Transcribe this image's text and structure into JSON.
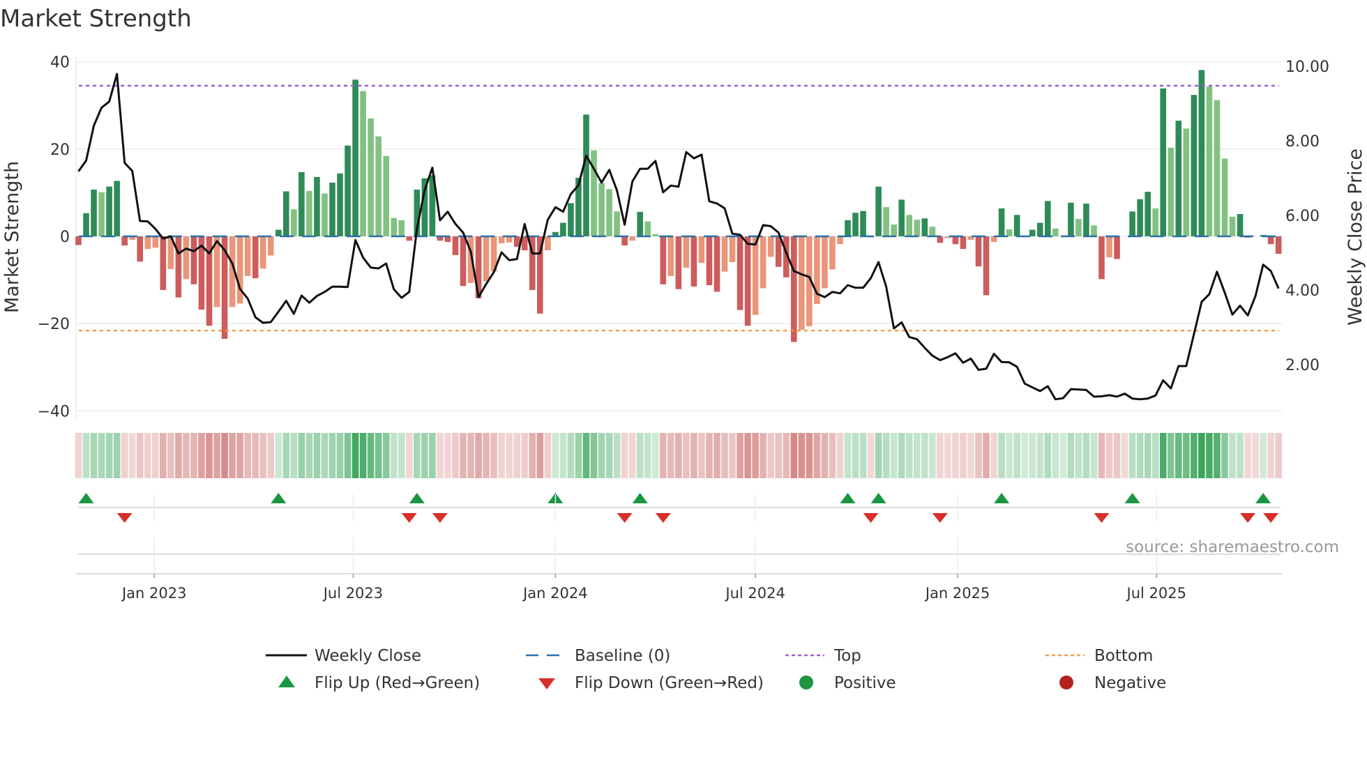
{
  "chart_data": {
    "type": "bar",
    "title": "Market Strength",
    "ylabel": "Market Strength",
    "y2label": "Weekly Close Price",
    "ylim": [
      -40,
      40
    ],
    "y2lim": [
      0,
      10.5
    ],
    "yticks": [
      "40",
      "20",
      "0",
      "−20",
      "−40"
    ],
    "ytick_values": [
      40,
      20,
      0,
      -20,
      -40
    ],
    "y2ticks": [
      "10.00",
      "8.00",
      "6.00",
      "4.00",
      "2.00"
    ],
    "y2tick_values": [
      10,
      8,
      6,
      4,
      2
    ],
    "xticks": [
      {
        "label": "Jan 2023",
        "date": "2023-01-01"
      },
      {
        "label": "Jul 2023",
        "date": "2023-07-01"
      },
      {
        "label": "Jan 2024",
        "date": "2024-01-01"
      },
      {
        "label": "Jul 2024",
        "date": "2024-07-01"
      },
      {
        "label": "Jan 2025",
        "date": "2025-01-01"
      },
      {
        "label": "Jul 2025",
        "date": "2025-07-01"
      }
    ],
    "x_start_date": "2022-10-24",
    "x_step_days": 7,
    "top_level": 34.5,
    "bottom_level": -21.6,
    "baseline": 0,
    "strength": [
      -2,
      5.3,
      10.7,
      10.1,
      11.4,
      12.7,
      -2.1,
      -0.8,
      -5.8,
      -2.9,
      -2.6,
      -12.3,
      -7.5,
      -14,
      -9.8,
      -11,
      -16.8,
      -20.5,
      -16.2,
      -23.5,
      -16.2,
      -15.4,
      -9.1,
      -9.6,
      -7.4,
      -4.4,
      1.5,
      10.3,
      6.2,
      14.7,
      10.4,
      13.6,
      9.8,
      12.3,
      14.4,
      20.8,
      35.9,
      33.3,
      27,
      22.9,
      18.4,
      4.2,
      3.7,
      -1,
      10.7,
      13.3,
      14,
      -1,
      -1.3,
      -4.3,
      -11.4,
      -10.7,
      -14.2,
      -10.3,
      -8.1,
      -1.6,
      -1.4,
      -2.4,
      -3.2,
      -12.3,
      -17.7,
      -3.2,
      1,
      3.1,
      7.6,
      13.4,
      27.9,
      19.7,
      12.2,
      10.8,
      5.7,
      -2.1,
      -1,
      5.6,
      3.4,
      0.5,
      -11,
      -9.1,
      -12.1,
      -7.2,
      -11.5,
      -6.1,
      -11.2,
      -12.7,
      -8.1,
      -5.9,
      -16.9,
      -20.5,
      -18,
      -11.9,
      -4.7,
      -7,
      -9.4,
      -24.2,
      -21.4,
      -20.6,
      -15.5,
      -11.9,
      -7.6,
      -1.8,
      3.7,
      5.4,
      5.8,
      -0.2,
      11.4,
      6.7,
      2.7,
      8.4,
      4.9,
      3.8,
      4.1,
      2.2,
      -1.5,
      -0.4,
      -1.8,
      -2.9,
      -0.8,
      -6.9,
      -13.5,
      -1.3,
      6.4,
      1.6,
      4.9,
      0,
      1.5,
      3.1,
      8.1,
      1.8,
      0,
      7.7,
      4,
      7.5,
      2.5,
      -9.8,
      -4.8,
      -5.2,
      0,
      5.7,
      8.5,
      10.2,
      6.4,
      33.9,
      20.3,
      26.5,
      24.7,
      32.4,
      38.1,
      34.3,
      31.2,
      17.8,
      4.5,
      5.1,
      -0.3,
      0,
      0.3,
      -1.8,
      -4
    ],
    "weekly_close": [
      7.18,
      7.47,
      8.41,
      8.89,
      9.05,
      9.79,
      7.41,
      7.19,
      5.85,
      5.84,
      5.64,
      5.38,
      5.44,
      4.98,
      5.11,
      5.04,
      5.19,
      4.98,
      5.31,
      5.07,
      4.71,
      4.03,
      3.77,
      3.27,
      3.12,
      3.14,
      3.42,
      3.71,
      3.36,
      3.85,
      3.66,
      3.84,
      3.95,
      4.09,
      4.09,
      4.08,
      5.34,
      4.87,
      4.6,
      4.58,
      4.71,
      4.02,
      3.79,
      3.95,
      5.64,
      6.67,
      7.28,
      5.87,
      6.1,
      5.77,
      5.54,
      5.03,
      3.81,
      4.16,
      4.48,
      5.01,
      4.8,
      4.83,
      5.77,
      4.98,
      4.98,
      5.88,
      6.22,
      6.1,
      6.57,
      6.81,
      7.6,
      7.25,
      6.88,
      7.22,
      6.67,
      5.75,
      6.91,
      7.25,
      7.25,
      7.46,
      6.62,
      6.8,
      6.77,
      7.7,
      7.53,
      7.63,
      6.38,
      6.32,
      6.19,
      5.51,
      5.48,
      5.24,
      5.22,
      5.74,
      5.71,
      5.54,
      5.0,
      4.51,
      4.42,
      4.35,
      3.9,
      3.81,
      3.95,
      3.91,
      4.13,
      4.06,
      4.06,
      4.32,
      4.75,
      4.09,
      2.97,
      3.13,
      2.74,
      2.68,
      2.45,
      2.24,
      2.12,
      2.2,
      2.3,
      2.05,
      2.16,
      1.86,
      1.89,
      2.29,
      2.07,
      2.06,
      1.94,
      1.49,
      1.39,
      1.29,
      1.42,
      1.07,
      1.1,
      1.34,
      1.33,
      1.32,
      1.14,
      1.15,
      1.18,
      1.14,
      1.22,
      1.09,
      1.07,
      1.09,
      1.17,
      1.58,
      1.36,
      1.96,
      1.96,
      2.81,
      3.68,
      3.89,
      4.49,
      3.93,
      3.34,
      3.58,
      3.32,
      3.84,
      4.68,
      4.51,
      4.04
    ],
    "legend": {
      "placement": "bottom",
      "weekly_close": "Weekly Close",
      "baseline": "Baseline (0)",
      "top": "Top",
      "bottom": "Bottom",
      "flip_up": "Flip Up (Red→Green)",
      "flip_down": "Flip Down (Green→Red)",
      "positive": "Positive",
      "negative": "Negative"
    },
    "source": "source: sharemaestro.com"
  },
  "colors": {
    "pos_strong": "#2e8b57",
    "pos_weak": "#82c182",
    "neg_strong": "#cd5c5c",
    "neg_weak": "#e9967a",
    "price": "#111111",
    "baseline": "#2a6fa8",
    "top": "#9b5fd6",
    "bottom": "#f0a04b",
    "heat_pos": "#2e9e50",
    "heat_neg": "#c0504d",
    "flip_up": "#1a9641",
    "flip_down": "#d7302a",
    "positive": "#1e9640",
    "negative": "#b22222"
  }
}
